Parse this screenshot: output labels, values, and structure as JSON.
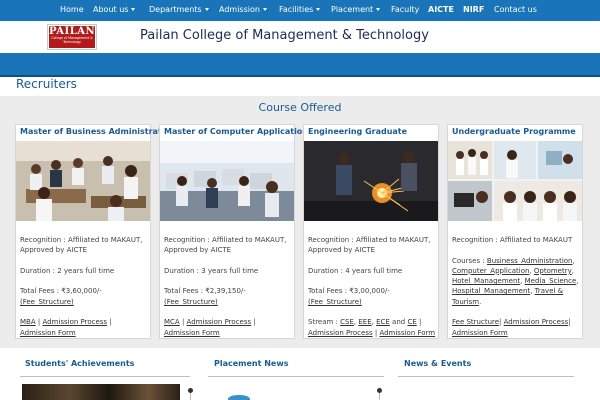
{
  "nav": {
    "items": [
      {
        "label": "Home",
        "dropdown": false
      },
      {
        "label": "About us",
        "dropdown": true
      },
      {
        "label": "Departments",
        "dropdown": true
      },
      {
        "label": "Admission",
        "dropdown": true
      },
      {
        "label": "Facilities",
        "dropdown": true
      },
      {
        "label": "Placement",
        "dropdown": true
      },
      {
        "label": "Faculty",
        "dropdown": false
      },
      {
        "label": "AICTE",
        "dropdown": false
      },
      {
        "label": "NIRF",
        "dropdown": false
      },
      {
        "label": "Contact us",
        "dropdown": false
      }
    ]
  },
  "header": {
    "logo": {
      "line1": "PAILAN",
      "line2": "College of Management & Technology"
    },
    "title": "Pailan College of Management & Technology"
  },
  "recruiters_heading": "Recruiters",
  "courses": {
    "heading": "Course Offered",
    "cards": [
      {
        "title": "Master of Business Administration",
        "recognition": "Recognition : Affiliated to MAKAUT, Approved by AICTE",
        "duration": "Duration : 2 years full time",
        "fees_prefix": "Total Fees : ",
        "fees_amount": "₹3,60,000/-",
        "fee_structure": "(Fee_Structure)",
        "links": [
          "MBA",
          "Admission Process",
          "Admission Form"
        ]
      },
      {
        "title": "Master of Computer Applications",
        "recognition": "Recognition : Affiliated to MAKAUT, Approved by AICTE",
        "duration": "Duration : 3 years full time",
        "fees_prefix": "Total Fees : ",
        "fees_amount": "₹2,39,150/-",
        "fee_structure": "(Fee_Structure)",
        "links": [
          "MCA",
          "Admission Process",
          "Admission Form"
        ]
      },
      {
        "title": "Engineering Graduate",
        "recognition": "Recognition : Affiliated to MAKAUT, Approved by AICTE",
        "duration": "Duration : 4 years full time",
        "fees_prefix": "Total Fees : ",
        "fees_amount": "₹3,00,000/-",
        "fee_structure": "(Fee_Structure)",
        "stream_prefix": "Stream : ",
        "streams": [
          "CSE",
          "EEE",
          "ECE",
          "CE"
        ],
        "links": [
          "Admission Process",
          "Admission Form"
        ]
      },
      {
        "title": "Undergraduate Programme",
        "recognition": "Recognition : Affiliated to MAKAUT",
        "courses_prefix": "Courses : ",
        "course_links": [
          "Business_Administration",
          "Computer_Application",
          "Optometry",
          "Hotel_Management",
          "Media_Science",
          "Hospital_Management",
          "Travel & Tourism"
        ],
        "links": [
          "Fee Structure",
          "Admission Process",
          "Admission Form"
        ]
      }
    ]
  },
  "bottom": {
    "achievements": "Students' Achievements",
    "placement": "Placement News",
    "news": "News & Events"
  },
  "colors": {
    "nav_bg": "#1a74b8",
    "heading_blue": "#1a5a92",
    "section_bg": "#ececec"
  }
}
